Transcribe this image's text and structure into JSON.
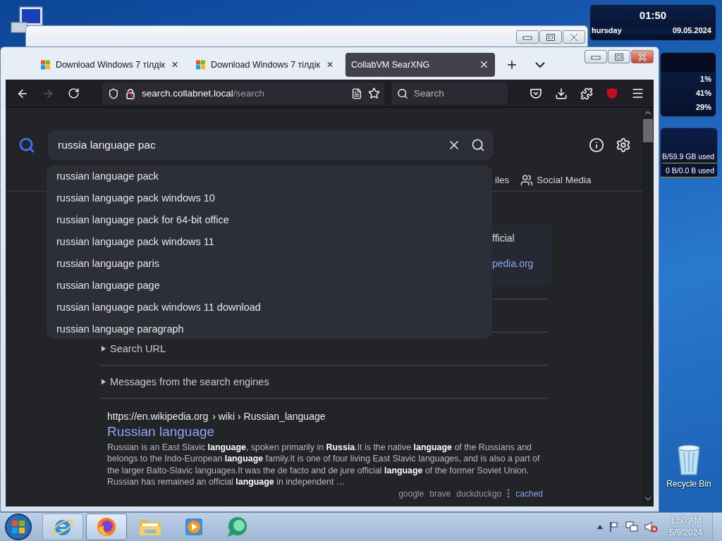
{
  "desktop": {
    "icons": [
      {
        "label": "Recycle Bin"
      }
    ]
  },
  "gadgets": {
    "clock": {
      "time": "01:50",
      "day": "hursday",
      "date": "09.05.2024"
    },
    "cpu": {
      "readings": [
        "1%",
        "41%",
        "29%"
      ]
    },
    "drive": {
      "readings": [
        "B/59.9 GB used",
        "0 B/0.0 B used"
      ]
    }
  },
  "browser": {
    "tabs": [
      {
        "title": "Download Windows 7 тілдік",
        "kind": "windows",
        "selected": false
      },
      {
        "title": "Download Windows 7 тілдік",
        "kind": "windows",
        "selected": false
      },
      {
        "title": "CollabVM SearXNG",
        "kind": "plain",
        "selected": true
      }
    ],
    "nav": [
      {
        "kind": "back",
        "disabled": false
      },
      {
        "kind": "forward",
        "disabled": true
      },
      {
        "kind": "reload",
        "disabled": false
      }
    ],
    "address": {
      "host": "search.collabnet.local",
      "path": "/search"
    },
    "search_box": {
      "placeholder": "Search"
    }
  },
  "page": {
    "query": "russia language pac",
    "suggestions": [
      "russian language pack",
      "russian language pack windows 10",
      "russian language pack for 64-bit office",
      "russian language pack windows 11",
      "russian language paris",
      "russian language page",
      "russian language pack windows 11 download",
      "russian language paragraph"
    ],
    "categories": [
      {
        "label": "iles",
        "kind": "text"
      },
      {
        "label": "Social Media",
        "kind": "people"
      }
    ],
    "infobox": {
      "text": "fficial",
      "link": "pedia.org"
    },
    "sections": [
      {
        "label": "Search URL",
        "expanded": false
      },
      {
        "label": "Messages from the search engines",
        "expanded": false
      }
    ],
    "results": [
      {
        "url": "https://en.wikipedia.org",
        "path": "› wiki › Russian_language",
        "title": "Russian language",
        "snippet": "Russian is an East Slavic **language**, spoken primarily in **Russia**.It is the native **language** of the Russians and belongs to the Indo-European **language** family.It is one of four living East Slavic languages, and is also a part of the larger Balto-Slavic languages.It was the de facto and de jure official **language** of the former Soviet Union. Russian has remained an official **language** in independent …",
        "engines": [
          "google",
          "brave",
          "duckduckgo"
        ],
        "cached": "cached"
      }
    ]
  },
  "taskbar": {
    "apps": [
      {
        "kind": "ie",
        "running": true,
        "selected": false
      },
      {
        "kind": "firefox",
        "running": true,
        "selected": true
      },
      {
        "kind": "explorer",
        "running": false,
        "selected": false
      },
      {
        "kind": "media",
        "running": false,
        "selected": false
      },
      {
        "kind": "chat",
        "running": false,
        "selected": false
      }
    ],
    "tray": {
      "volume_muted": true,
      "time": "1:50 AM",
      "date": "5/9/2024"
    }
  }
}
